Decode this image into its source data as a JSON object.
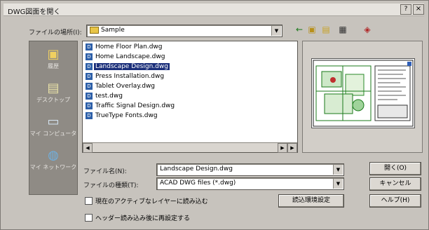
{
  "window": {
    "title": "DWG図面を開く",
    "help_label": "?",
    "close_label": "×"
  },
  "toolbar": {
    "look_in_label": "ファイルの場所(I):",
    "look_in_value": "Sample",
    "icons": [
      "back-arrow-icon",
      "up-folder-icon",
      "new-folder-icon",
      "view-menu-icon",
      "tools-icon"
    ]
  },
  "places": [
    {
      "label": "履歴",
      "icon": "history-icon"
    },
    {
      "label": "デスクトップ",
      "icon": "desktop-icon"
    },
    {
      "label": "マイ コンピュータ",
      "icon": "my-computer-icon"
    },
    {
      "label": "マイ ネットワーク",
      "icon": "network-icon"
    }
  ],
  "files": [
    {
      "name": "Home Floor Plan.dwg",
      "selected": false
    },
    {
      "name": "Home Landscape.dwg",
      "selected": false
    },
    {
      "name": "Landscape Design.dwg",
      "selected": true
    },
    {
      "name": "Press Installation.dwg",
      "selected": false
    },
    {
      "name": "Tablet Overlay.dwg",
      "selected": false
    },
    {
      "name": "test.dwg",
      "selected": false
    },
    {
      "name": "Traffic Signal Design.dwg",
      "selected": false
    },
    {
      "name": "TrueType Fonts.dwg",
      "selected": false
    }
  ],
  "filename": {
    "label": "ファイル名(N):",
    "value": "Landscape Design.dwg"
  },
  "filetype": {
    "label": "ファイルの種類(T):",
    "value": "ACAD DWG files (*.dwg)"
  },
  "checkboxes": {
    "xref": "現在のアクティブなレイヤーに読み込む",
    "header": "ヘッダー読み込み後に再設定する"
  },
  "buttons": {
    "open": "開く(O)",
    "cancel": "キャンセル",
    "help": "ヘルプ(H)",
    "env": "読込環境設定"
  },
  "colors": {
    "dialog_bg": "#c7c3bd",
    "selection": "#1b2f7a",
    "places_bg": "#8f8b85"
  }
}
